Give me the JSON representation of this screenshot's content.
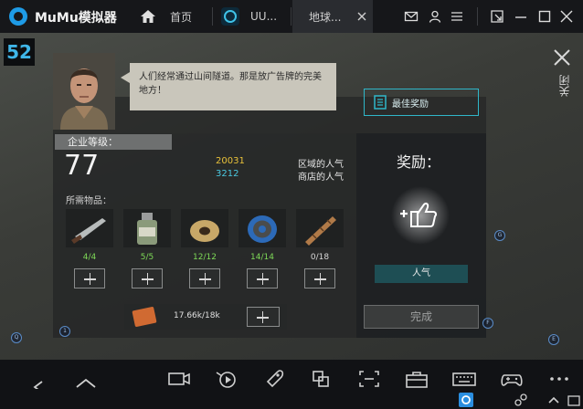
{
  "app": {
    "title": "MuMu模拟器"
  },
  "tabs": [
    {
      "label": "首页"
    },
    {
      "label": "UU..."
    },
    {
      "label": "地球...",
      "active": true
    }
  ],
  "game": {
    "level_badge": "52",
    "close_label": "关闭",
    "dialog": "人们经常通过山间隧道。那是放广告牌的完美地方！",
    "best_reward_label": "最佳奖励",
    "enterprise_label": "企业等级：",
    "enterprise_level": "77",
    "stats": [
      {
        "value": "20031",
        "label": "区域的人气",
        "color": "#e8c13a"
      },
      {
        "value": "3212",
        "label": "商店的人气",
        "color": "#4ac8e0"
      }
    ],
    "needed_label": "所需物品：",
    "items": [
      {
        "name": "knife",
        "count": "4/4",
        "complete": true
      },
      {
        "name": "bottle",
        "count": "5/5",
        "complete": true
      },
      {
        "name": "wire-spool",
        "count": "12/12",
        "complete": true
      },
      {
        "name": "cable-reel",
        "count": "14/14",
        "complete": true
      },
      {
        "name": "rolled-paper",
        "count": "0/18",
        "complete": false
      }
    ],
    "ticket_value": "17.66k/18k",
    "reward_title": "奖励：",
    "reward_tag": "人气",
    "done_label": "完成",
    "markers": [
      "Q",
      "1",
      "G",
      "F",
      "E"
    ]
  },
  "colors": {
    "accent": "#2fb7c9",
    "complete": "#7ed957",
    "incomplete": "#d8d8d8",
    "badge": "#3fb6e8"
  }
}
